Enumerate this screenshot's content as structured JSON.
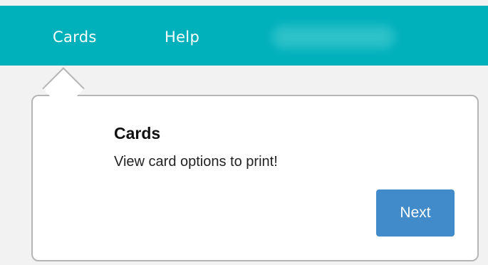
{
  "nav": {
    "items": [
      {
        "label": "Cards"
      },
      {
        "label": "Help"
      }
    ]
  },
  "tour": {
    "title": "Cards",
    "text": "View card options to print!",
    "next_label": "Next"
  },
  "colors": {
    "nav_background": "#00b0bb",
    "page_background": "#f2f2f2",
    "button": "#428bca",
    "bubble_border": "#b5b5b5"
  }
}
